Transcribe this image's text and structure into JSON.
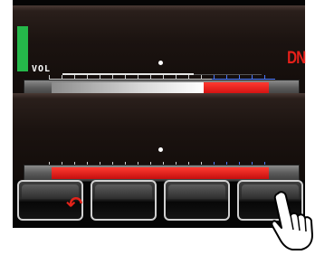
{
  "screen": {
    "top_panel": {
      "vol_label": "VOL",
      "mode_label": "DN",
      "level_color": "#25b84a",
      "meter": {
        "white_fraction": 0.64,
        "red_fraction": 0.26
      }
    },
    "bottom_panel": {
      "meter": {
        "red_fraction": 0.9
      }
    },
    "soft_keys": [
      {
        "icon": "undo-arrow-icon"
      },
      {
        "icon": ""
      },
      {
        "icon": ""
      },
      {
        "icon": ""
      }
    ],
    "pointer": {
      "icon": "hand-pointer-icon"
    },
    "colors": {
      "accent_red": "#e2231a",
      "accent_blue": "#4a78ff",
      "text": "#ffffff"
    }
  }
}
